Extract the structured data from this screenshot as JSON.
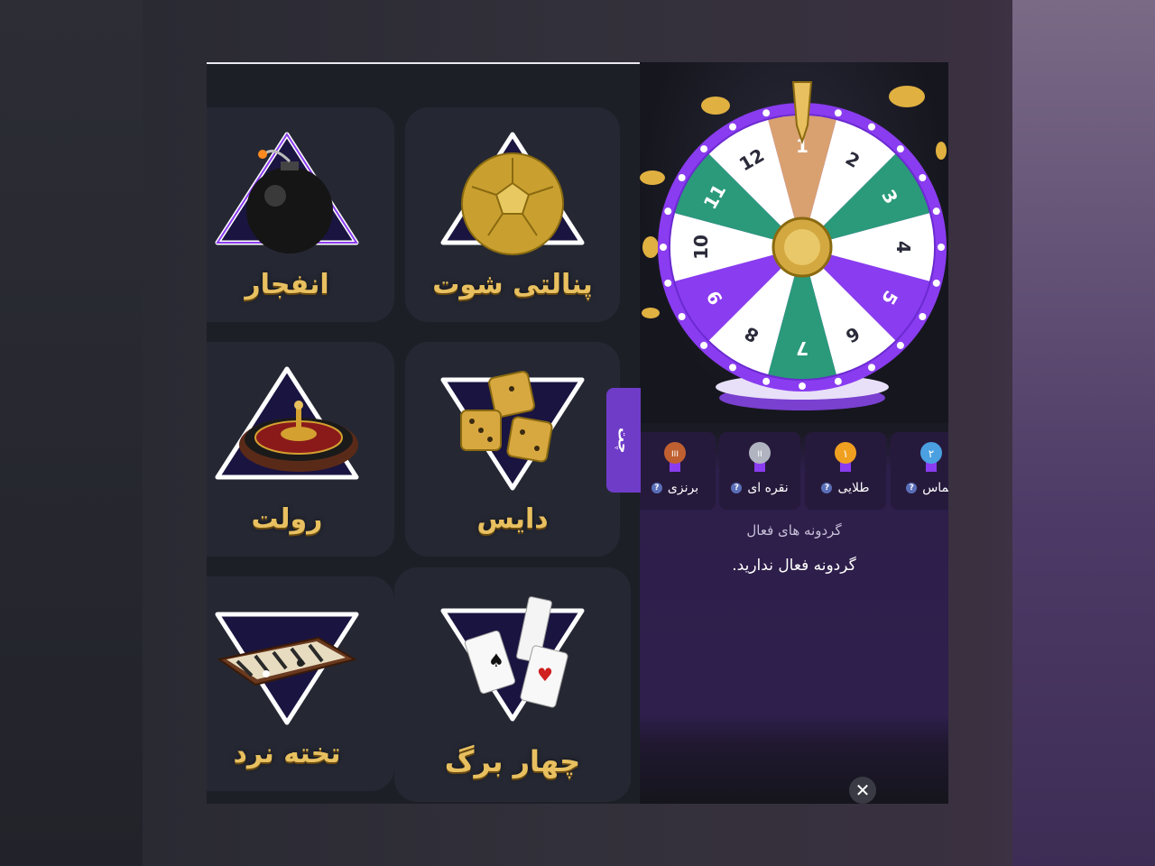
{
  "games": [
    {
      "label": "انفجار",
      "icon": "bomb-icon"
    },
    {
      "label": "پنالتی شوت",
      "icon": "soccer-ball-icon"
    },
    {
      "label": "رولت",
      "icon": "roulette-icon"
    },
    {
      "label": "دایس",
      "icon": "dice-icon"
    },
    {
      "label": "تخته نرد",
      "icon": "backgammon-icon"
    },
    {
      "label": "چهار برگ",
      "icon": "playing-cards-icon"
    }
  ],
  "chat_tab": {
    "label": "چت"
  },
  "wheel": {
    "numbers": [
      "1",
      "2",
      "3",
      "4",
      "5",
      "6",
      "7",
      "8",
      "9",
      "10",
      "11",
      "12"
    ]
  },
  "tiers": [
    {
      "name": "الماس",
      "medal_text": "۲",
      "color": "#4aa0e0"
    },
    {
      "name": "طلایی",
      "medal_text": "۱",
      "color": "#f0a020"
    },
    {
      "name": "نقره ای",
      "medal_text": "II",
      "color": "#b0b4c0"
    },
    {
      "name": "برنزی",
      "medal_text": "III",
      "color": "#c06030"
    }
  ],
  "active_wheels_title": "گردونه های فعال",
  "no_active_message": "گردونه فعال ندارید.",
  "colors": {
    "accent": "#6f3cc8",
    "gold": "#e8c060"
  }
}
